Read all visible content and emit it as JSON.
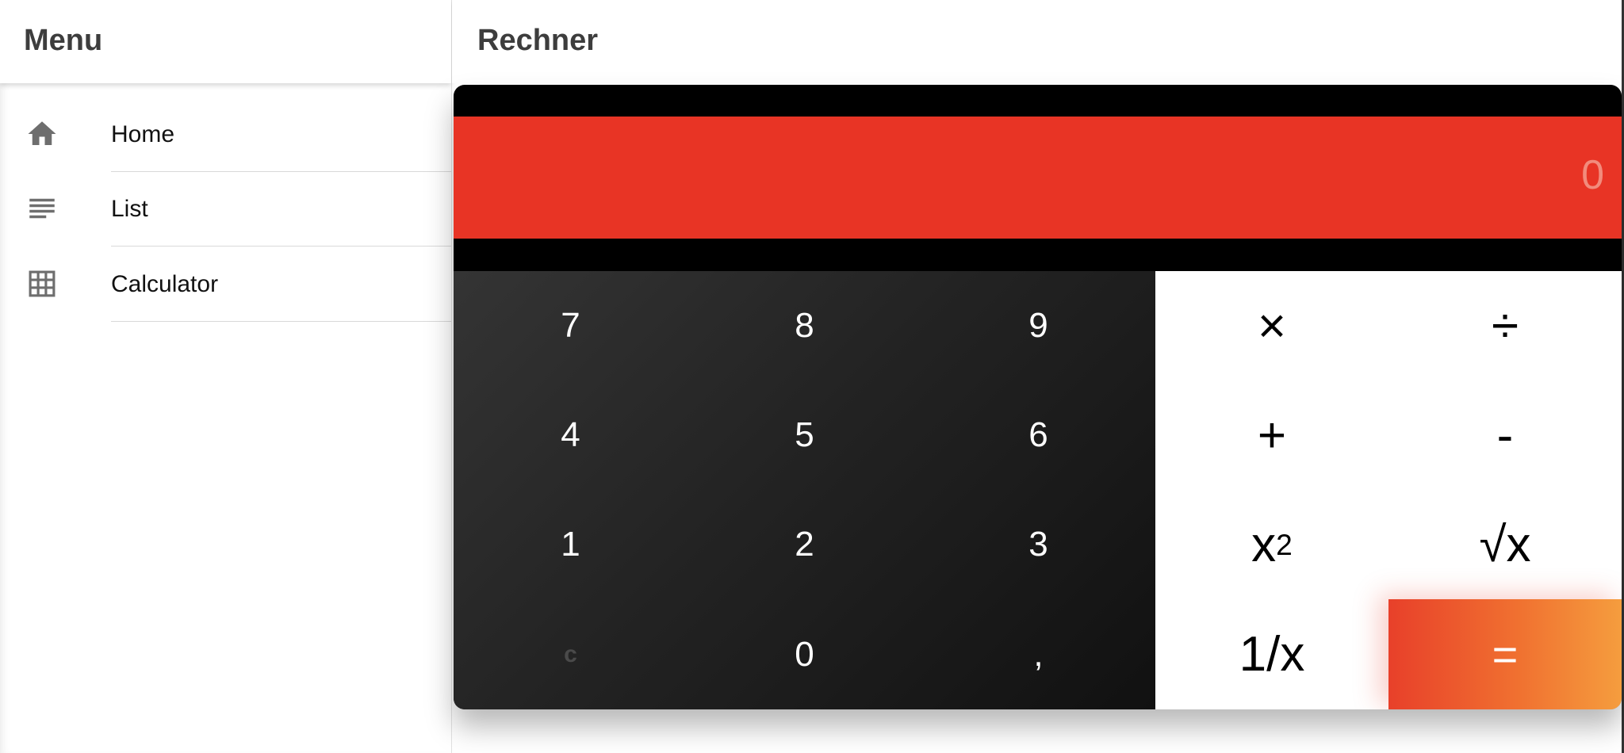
{
  "sidebar": {
    "title": "Menu",
    "items": [
      {
        "label": "Home",
        "icon": "home-icon"
      },
      {
        "label": "List",
        "icon": "list-icon"
      },
      {
        "label": "Calculator",
        "icon": "grid-icon"
      }
    ]
  },
  "main": {
    "title": "Rechner"
  },
  "calculator": {
    "display": "0",
    "digits": {
      "seven": "7",
      "eight": "8",
      "nine": "9",
      "four": "4",
      "five": "5",
      "six": "6",
      "one": "1",
      "two": "2",
      "three": "3",
      "clear": "c",
      "zero": "0",
      "comma": ","
    },
    "operators": {
      "multiply": "×",
      "divide": "÷",
      "plus": "+",
      "minus": "-",
      "square_base": "x",
      "square_exp": "2",
      "sqrt": "√x",
      "reciprocal": "1/x",
      "equals": "="
    },
    "colors": {
      "display_bg": "#e83425",
      "display_text": "#f28b7c",
      "equals_start": "#e8402a",
      "equals_end": "#f59d3e"
    }
  }
}
